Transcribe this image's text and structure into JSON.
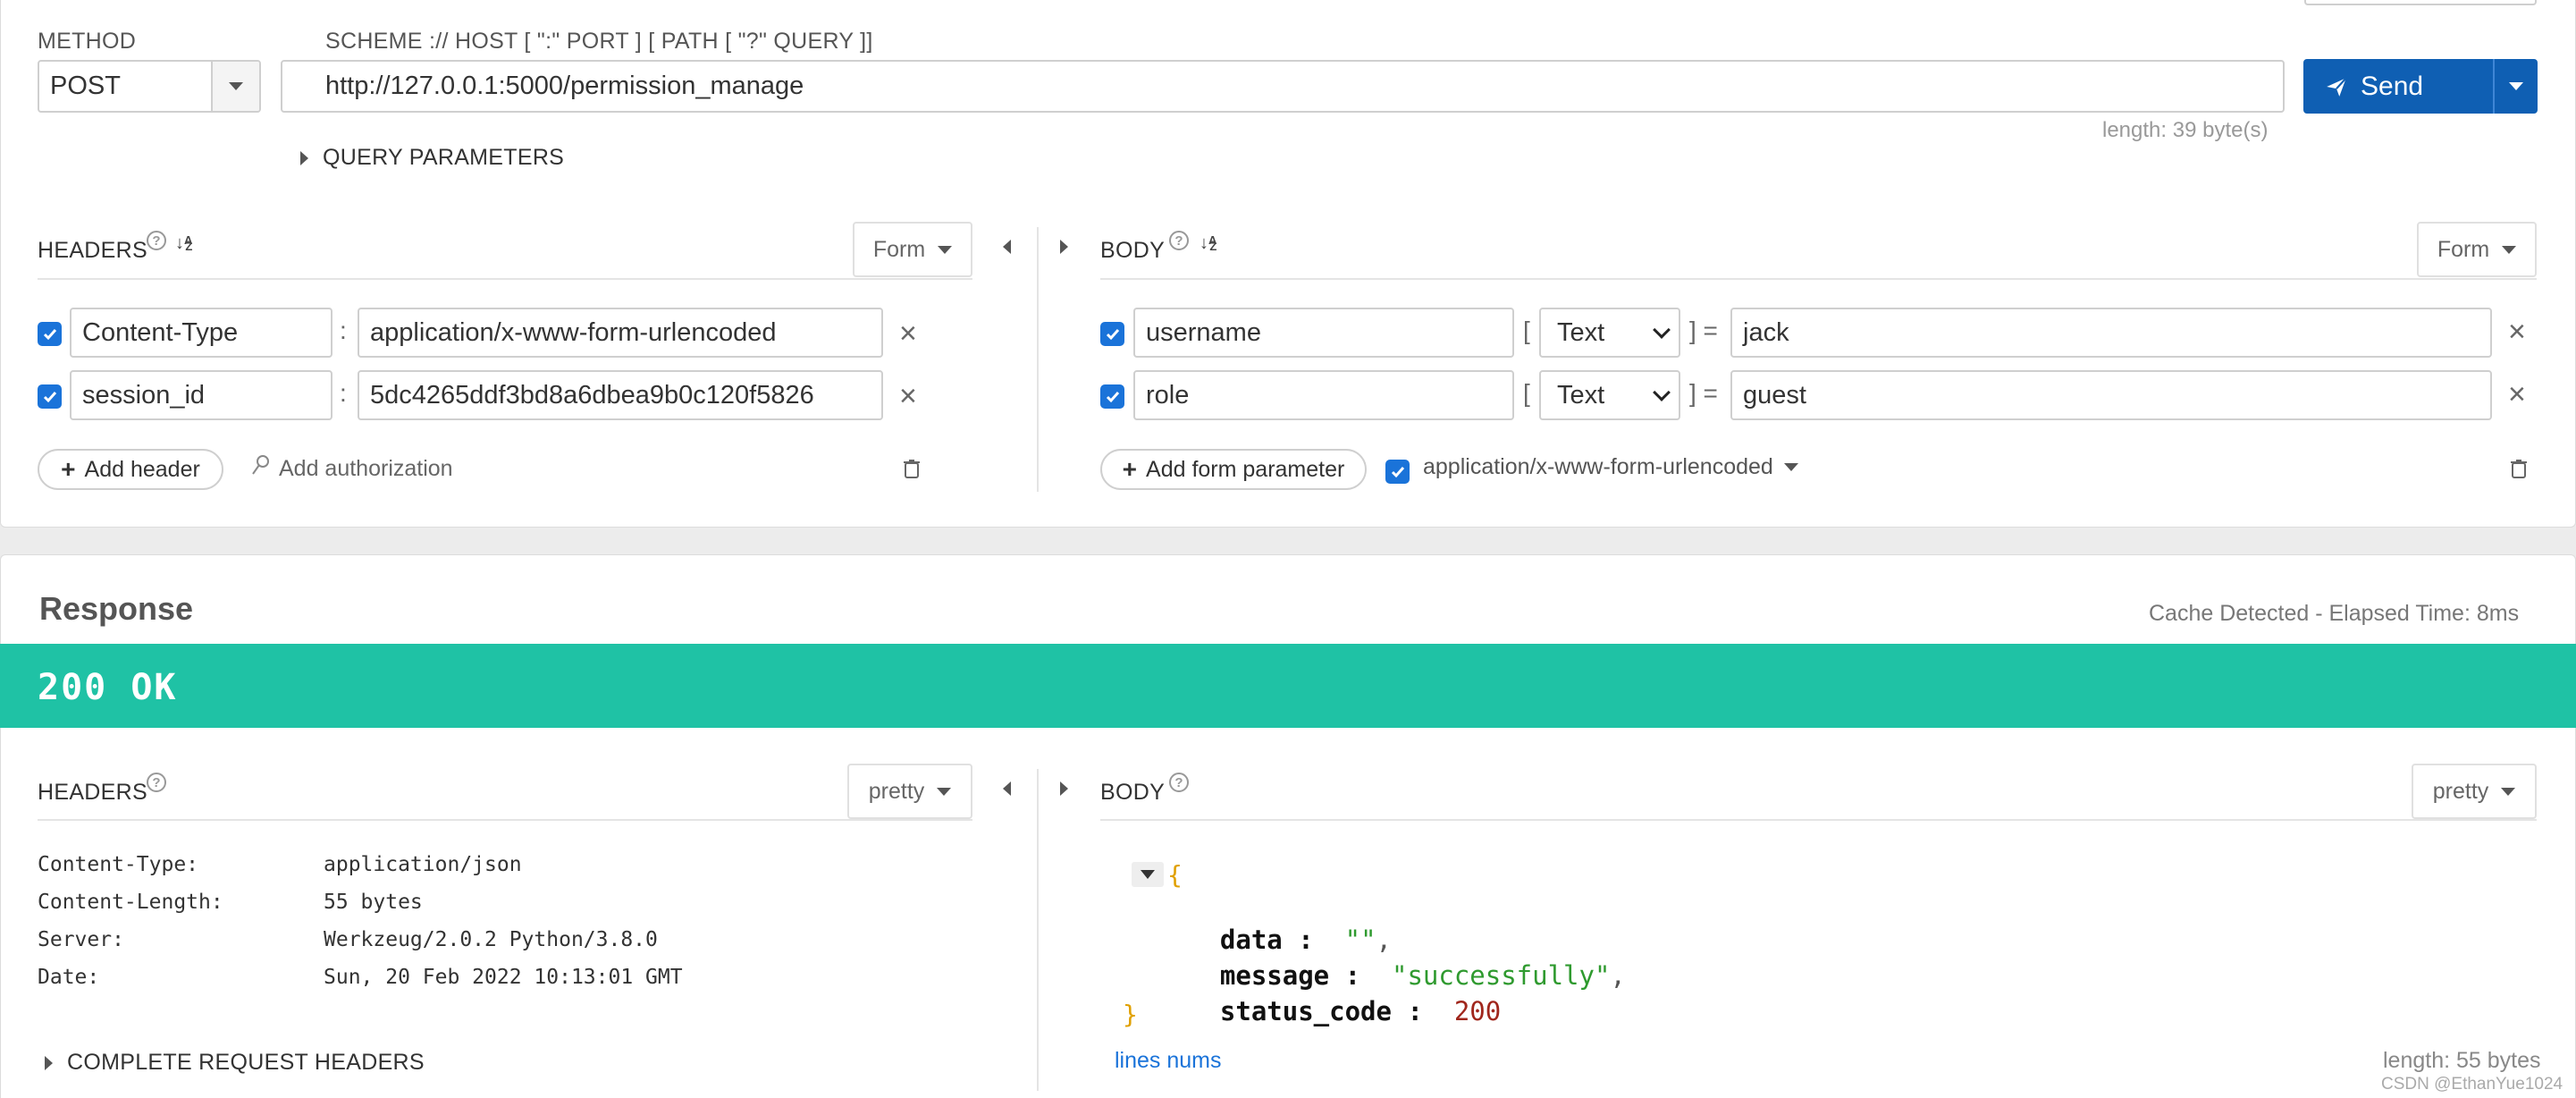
{
  "request": {
    "method_label": "METHOD",
    "method_value": "POST",
    "url_label": "SCHEME :// HOST [ \":\" PORT ] [ PATH [ \"?\" QUERY ]]",
    "url_value": "http://127.0.0.1:5000/permission_manage",
    "length_text": "length: 39 byte(s)",
    "send_label": "Send",
    "query_params_label": "QUERY PARAMETERS",
    "headers": {
      "title": "HEADERS",
      "format": "Form",
      "rows": [
        {
          "name": "Content-Type",
          "value": "application/x-www-form-urlencoded"
        },
        {
          "name": "session_id",
          "value": "5dc4265ddf3bd8a6dbea9b0c120f5826"
        }
      ],
      "add_header_label": "Add header",
      "add_auth_label": "Add authorization"
    },
    "body": {
      "title": "BODY",
      "format": "Form",
      "rows": [
        {
          "name": "username",
          "type": "Text",
          "value": "jack"
        },
        {
          "name": "role",
          "type": "Text",
          "value": "guest"
        }
      ],
      "add_param_label": "Add form parameter",
      "content_type": "application/x-www-form-urlencoded"
    }
  },
  "response": {
    "title": "Response",
    "cache_info": "Cache Detected - Elapsed Time: 8ms",
    "status": "200 OK",
    "status_color": "#1fc2a5",
    "headers": {
      "title": "HEADERS",
      "format": "pretty",
      "rows": [
        {
          "key": "Content-Type:",
          "value": "application/json"
        },
        {
          "key": "Content-Length:",
          "value": "55 bytes"
        },
        {
          "key": "Server:",
          "value": "Werkzeug/2.0.2 Python/3.8.0"
        },
        {
          "key": "Date:",
          "value": "Sun, 20 Feb 2022 10:13:01 GMT"
        }
      ],
      "complete_label": "COMPLETE REQUEST HEADERS"
    },
    "body": {
      "title": "BODY",
      "format": "pretty",
      "open_brace": "{",
      "close_brace": "}",
      "lines": [
        {
          "key": "data",
          "value": "\"\"",
          "trail": ","
        },
        {
          "key": "message",
          "value": "\"successfully\"",
          "trail": ","
        },
        {
          "key": "status_code",
          "value": "200",
          "trail": ""
        }
      ],
      "lines_nums_label": "lines nums",
      "length_text": "length: 55 bytes"
    }
  },
  "watermark": "CSDN @EthanYue1024",
  "colors": {
    "accent": "#1a73d9",
    "send_bg": "#0f5fb3",
    "string": "#2f9a2f",
    "number": "#a0261c",
    "brace": "#e0a000"
  }
}
